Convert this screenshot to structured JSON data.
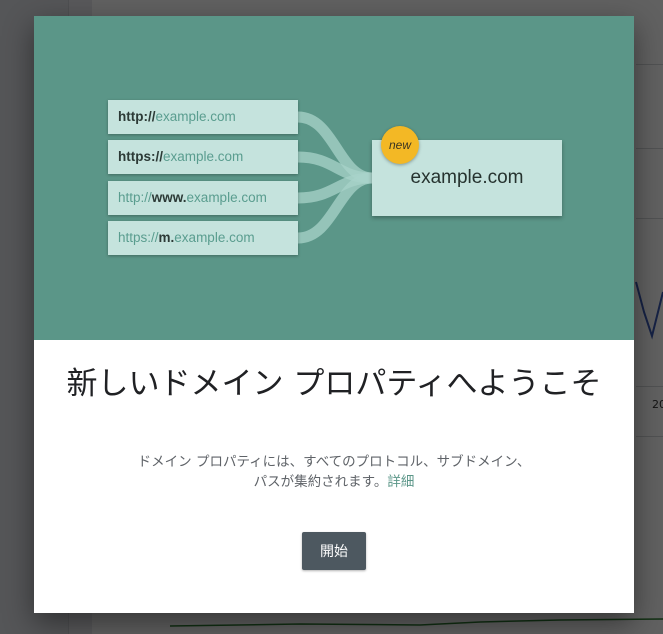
{
  "hero": {
    "urls": [
      {
        "scheme": "http://",
        "host_prefix": "",
        "host": "example.com"
      },
      {
        "scheme": "https://",
        "host_prefix": "",
        "host": "example.com"
      },
      {
        "scheme": "http://",
        "host_prefix": "www.",
        "host": "example.com"
      },
      {
        "scheme": "https://",
        "host_prefix": "m.",
        "host": "example.com"
      }
    ],
    "domain": "example.com",
    "badge": "new"
  },
  "dialog": {
    "title": "新しいドメイン プロパティへようこそ",
    "description": "ドメイン プロパティには、すべてのプロトコル、サブドメイン、パスが集約されます。",
    "learn_more": "詳細",
    "start_button": "開始"
  },
  "background": {
    "chart_year_label": "20"
  },
  "colors": {
    "hero_bg": "#5b9688",
    "url_box": "#c5e3dd",
    "badge": "#f3b825",
    "button": "#4d5860",
    "link": "#5b9688"
  }
}
